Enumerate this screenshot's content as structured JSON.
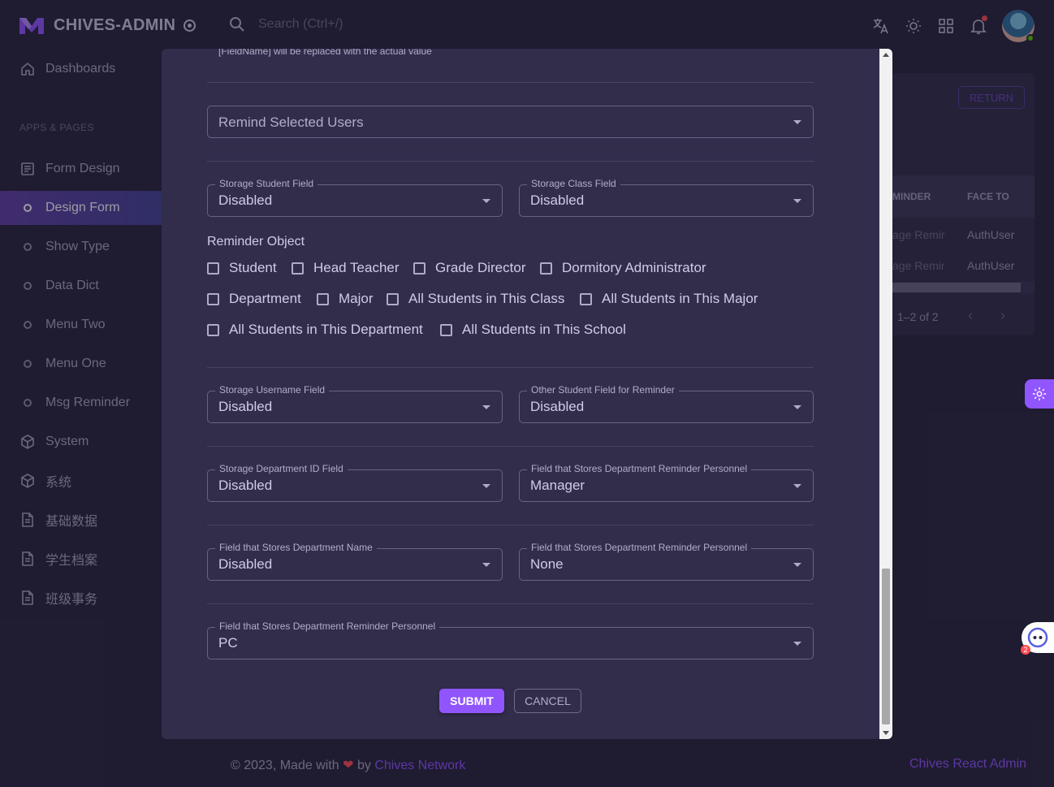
{
  "app": {
    "brand_name": "CHIVES-ADMIN"
  },
  "search": {
    "placeholder": "Search (Ctrl+/)"
  },
  "navbar": {
    "icons": [
      "translate-icon",
      "theme-icon",
      "apps-grid-icon",
      "notification-icon"
    ]
  },
  "sidebar": {
    "dashboards": "Dashboards",
    "section_label": "APPS & PAGES",
    "items": [
      {
        "label": "Form Design",
        "icon": "form-icon"
      },
      {
        "label": "Design Form",
        "icon": "circle-icon"
      },
      {
        "label": "Show Type",
        "icon": "circle-icon"
      },
      {
        "label": "Data Dict",
        "icon": "circle-icon"
      },
      {
        "label": "Menu Two",
        "icon": "circle-icon"
      },
      {
        "label": "Menu One",
        "icon": "circle-icon"
      },
      {
        "label": "Msg Reminder",
        "icon": "circle-icon"
      },
      {
        "label": "System",
        "icon": "cube-icon"
      },
      {
        "label": "系统",
        "icon": "cube-icon"
      },
      {
        "label": "基础数据",
        "icon": "document-icon"
      },
      {
        "label": "学生档案",
        "icon": "document-icon"
      },
      {
        "label": "班级事务",
        "icon": "document-icon"
      }
    ]
  },
  "background": {
    "return_label": "RETURN",
    "columns": [
      "MINDER",
      "FACE TO"
    ],
    "rows": [
      [
        "age Remir",
        "AuthUser"
      ],
      [
        "age Remir",
        "AuthUser"
      ]
    ],
    "pager": "1–2 of 2"
  },
  "dialog": {
    "hint": "[FieldName] will be replaced with the actual value",
    "remind_select": {
      "placeholder": "Remind Selected Users"
    },
    "row1": [
      {
        "label": "Storage Student Field",
        "value": "Disabled"
      },
      {
        "label": "Storage Class Field",
        "value": "Disabled"
      }
    ],
    "reminder_object": {
      "title": "Reminder Object",
      "options": [
        "Student",
        "Head Teacher",
        "Grade Director",
        "Dormitory Administrator",
        "Department",
        "Major",
        "All Students in This Class",
        "All Students in This Major",
        "All Students in This Department",
        "All Students in This School"
      ]
    },
    "row2": [
      {
        "label": "Storage Username Field",
        "value": "Disabled"
      },
      {
        "label": "Other Student Field for Reminder",
        "value": "Disabled"
      }
    ],
    "row3": [
      {
        "label": "Storage Department ID Field",
        "value": "Disabled"
      },
      {
        "label": "Field that Stores Department Reminder Personnel",
        "value": "Manager"
      }
    ],
    "row4": [
      {
        "label": "Field that Stores Department Name",
        "value": "Disabled"
      },
      {
        "label": "Field that Stores Department Reminder Personnel",
        "value": "None"
      }
    ],
    "row5": {
      "label": "Field that Stores Department Reminder Personnel",
      "value": "PC"
    },
    "submit_label": "SUBMIT",
    "cancel_label": "CANCEL"
  },
  "footer": {
    "copyright": "© 2023, Made with",
    "by": "by",
    "link": "Chives Network",
    "right_link": "Chives React Admin"
  },
  "chat_badge": "2",
  "colors": {
    "primary": "#9155fd",
    "background": "#28243d",
    "paper": "#312d4b",
    "error": "#ff4c51"
  }
}
